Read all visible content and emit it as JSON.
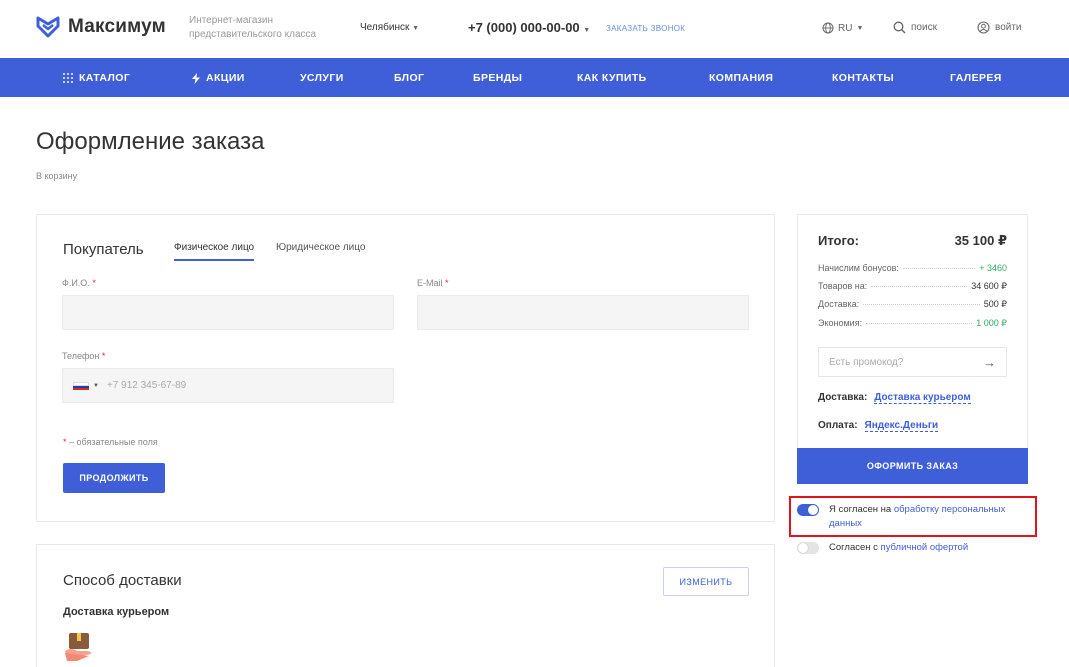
{
  "header": {
    "logo_text": "Максимум",
    "tagline": "Интернет-магазин представительского класса",
    "city": "Челябинск",
    "phone": "+7 (000) 000-00-00",
    "callback": "заказать звонок",
    "lang": "RU",
    "search": "поиск",
    "login": "войти"
  },
  "nav": {
    "items": [
      "Каталог",
      "Акции",
      "Услуги",
      "Блог",
      "Бренды",
      "Как купить",
      "Компания",
      "Контакты",
      "Галерея"
    ]
  },
  "page": {
    "title": "Оформление заказа",
    "back_link": "В корзину"
  },
  "buyer": {
    "title": "Покупатель",
    "tab_individual": "Физическое лицо",
    "tab_legal": "Юридическое лицо",
    "name_label": "Ф.И.О.",
    "email_label": "E-Mail",
    "phone_label": "Телефон",
    "required_mark": "*",
    "phone_placeholder": "+7 912 345-67-89",
    "required_note": " – обязательные поля",
    "continue_button": "Продолжить"
  },
  "delivery": {
    "title": "Способ доставки",
    "change_button": "Изменить",
    "method": "Доставка курьером"
  },
  "summary": {
    "total_label": "Итого:",
    "total_value": "35 100 ₽",
    "rows": [
      {
        "label": "Начислим бонусов:",
        "value": "+ 3460"
      },
      {
        "label": "Товаров на:",
        "value": "34 600 ₽"
      },
      {
        "label": "Доставка:",
        "value": "500 ₽"
      },
      {
        "label": "Экономия:",
        "value": "1 000 ₽"
      }
    ],
    "promo_placeholder": "Есть промокод?",
    "delivery_label": "Доставка:",
    "delivery_value": "Доставка курьером",
    "payment_label": "Оплата:",
    "payment_value": "Яндекс.Деньги",
    "checkout_button": "Оформить заказ"
  },
  "consents": {
    "personal_prefix": "Я согласен на ",
    "personal_link": "обработку персональных данных",
    "personal_checked": true,
    "offer_prefix": "Согласен с ",
    "offer_link": "публичной офертой",
    "offer_checked": false
  },
  "colors": {
    "accent": "#3f5fd8",
    "positive": "#2fae5c",
    "highlight_box": "#e0141c"
  }
}
